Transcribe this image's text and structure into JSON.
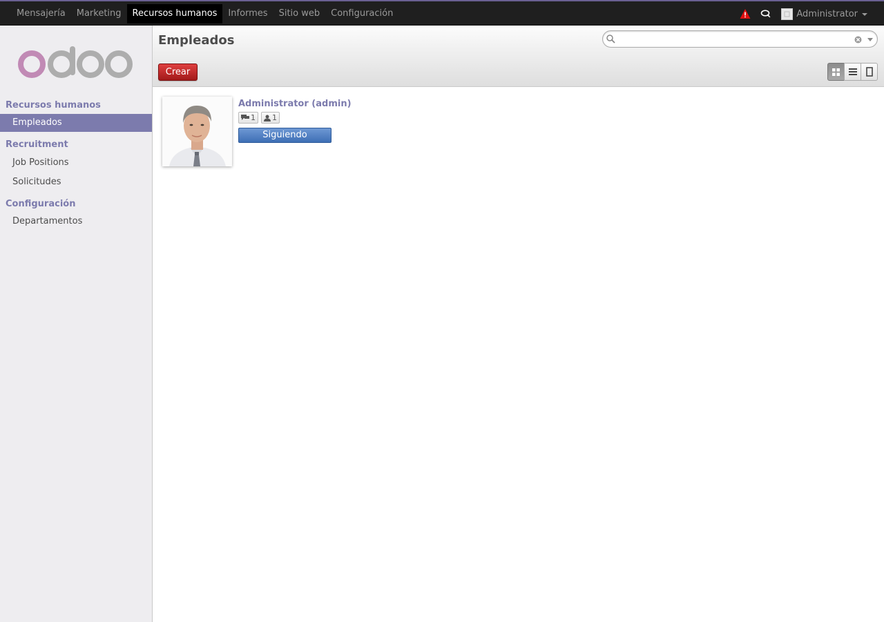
{
  "topbar": {
    "menu": [
      {
        "label": "Mensajería",
        "active": false
      },
      {
        "label": "Marketing",
        "active": false
      },
      {
        "label": "Recursos humanos",
        "active": true
      },
      {
        "label": "Informes",
        "active": false
      },
      {
        "label": "Sitio web",
        "active": false
      },
      {
        "label": "Configuración",
        "active": false
      }
    ],
    "user_name": "Administrator"
  },
  "sidebar": {
    "sections": [
      {
        "title": "Recursos humanos",
        "items": [
          {
            "label": "Empleados",
            "active": true
          }
        ]
      },
      {
        "title": "Recruitment",
        "items": [
          {
            "label": "Job Positions",
            "active": false
          },
          {
            "label": "Solicitudes",
            "active": false
          }
        ]
      },
      {
        "title": "Configuración",
        "items": [
          {
            "label": "Departamentos",
            "active": false
          }
        ]
      }
    ]
  },
  "header": {
    "title": "Empleados",
    "create_label": "Crear",
    "search": {
      "value": "",
      "placeholder": ""
    },
    "views": [
      "kanban-icon",
      "list-icon",
      "form-icon"
    ],
    "active_view": "kanban"
  },
  "employee": {
    "name": "Administrator (admin)",
    "messages_count": "1",
    "followers_count": "1",
    "follow_label": "Siguiendo"
  },
  "colors": {
    "accent": "#7c7bad",
    "topbar_bg": "#1f1f1f",
    "create_button": "#c12a2a",
    "follow_button": "#4a7bc0",
    "warning": "#e01010"
  }
}
